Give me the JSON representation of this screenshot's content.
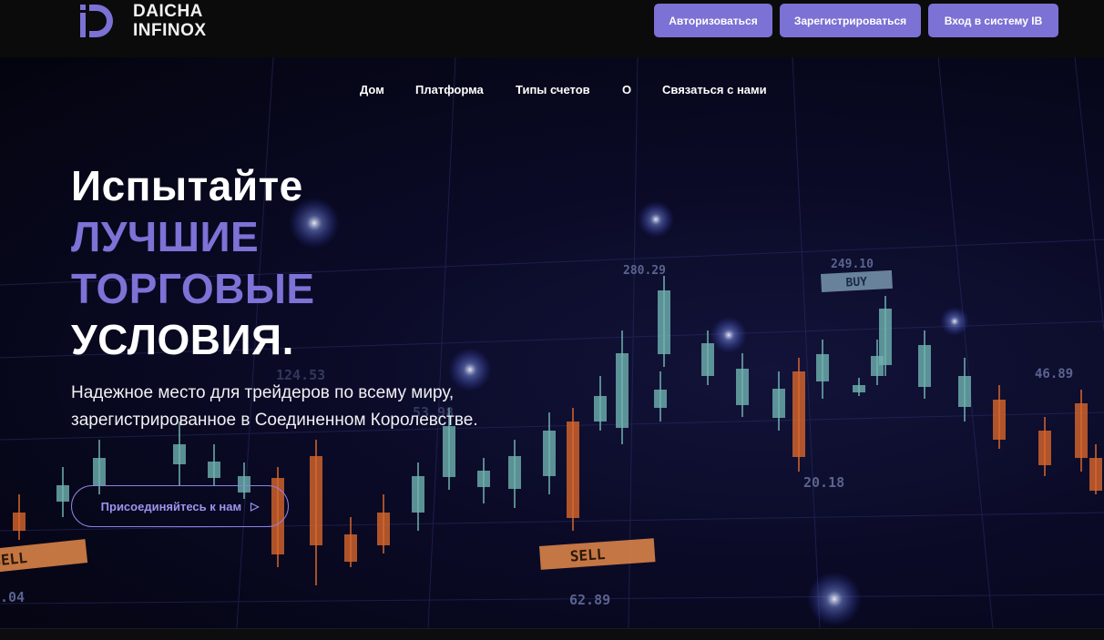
{
  "brand": {
    "line1": "DAICHA",
    "line2": "INFINOX"
  },
  "header_buttons": {
    "login": "Авторизоваться",
    "register": "Зарегистрироваться",
    "ib_login": "Вход в систему IB"
  },
  "nav": {
    "home": "Дом",
    "platform": "Платформа",
    "account_types": "Типы счетов",
    "about": "О",
    "contact": "Связаться с нами"
  },
  "hero": {
    "title_line1": "Испытайте",
    "title_line2": "ЛУЧШИЕ",
    "title_line3": "ТОРГОВЫЕ",
    "title_line4": "УСЛОВИЯ.",
    "description": "Надежное место для трейдеров по всему миру, зарегистрированное в Соединенном Королевстве.",
    "cta": "Присоединяйтесь к нам",
    "cta_icon": "triangle-right-icon"
  },
  "background_labels": {
    "price1": "280.29",
    "price2": "249.10",
    "buy": "BUY",
    "price3": "124.53",
    "price4": "53.98",
    "price5": "46.89",
    "price6": "20.18",
    "sell1": "SELL",
    "sell2": "SELL",
    "price7": "62.89",
    "price8": ".04"
  },
  "colors": {
    "accent": "#7c71d4",
    "accent_text": "#7d72d6",
    "header_bg": "#0b0b0c",
    "candle_up": "#6fb3b0",
    "candle_down": "#d8672c"
  }
}
